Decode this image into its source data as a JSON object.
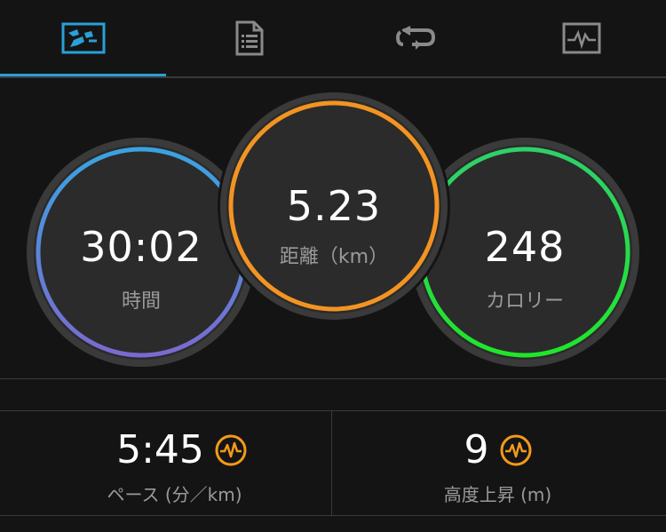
{
  "tabs": [
    {
      "icon": "activity-map-icon",
      "active": true
    },
    {
      "icon": "document-list-icon",
      "active": false
    },
    {
      "icon": "laps-loop-icon",
      "active": false
    },
    {
      "icon": "chart-graph-icon",
      "active": false
    }
  ],
  "colors": {
    "accent": "#2a9fd8",
    "time_ring_start": "#3aa3e0",
    "time_ring_end": "#7a6ad0",
    "distance_ring": "#f39422",
    "calorie_ring_start": "#2fd06a",
    "calorie_ring_end": "#1fe62a",
    "badge": "#f39a1c"
  },
  "summary": {
    "time": {
      "value": "30:02",
      "label": "時間"
    },
    "distance": {
      "value": "5.23",
      "label": "距離（km）"
    },
    "calories": {
      "value": "248",
      "label": "カロリー"
    }
  },
  "stats": {
    "pace": {
      "value": "5:45",
      "label": "ペース (分／km)",
      "icon": "heart-rate-badge-icon"
    },
    "elevation": {
      "value": "9",
      "label": "高度上昇 (m)",
      "icon": "heart-rate-badge-icon"
    }
  }
}
